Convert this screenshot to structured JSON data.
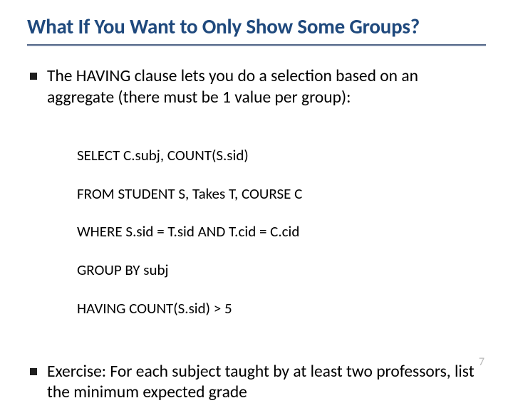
{
  "title": "What If You Want to Only Show Some Groups?",
  "bullets": [
    {
      "text": "The HAVING clause lets you do a selection based on an aggregate (there must be 1 value per group):"
    },
    {
      "text": "Exercise:  For each subject taught by at least two professors, list the minimum expected grade"
    }
  ],
  "code": {
    "lines": [
      "SELECT C.subj, COUNT(S.sid)",
      "FROM STUDENT S, Takes T, COURSE C",
      "WHERE S.sid = T.sid AND T.cid = C.cid",
      "GROUP BY subj",
      "HAVING COUNT(S.sid) > 5"
    ]
  },
  "page_number": "7"
}
